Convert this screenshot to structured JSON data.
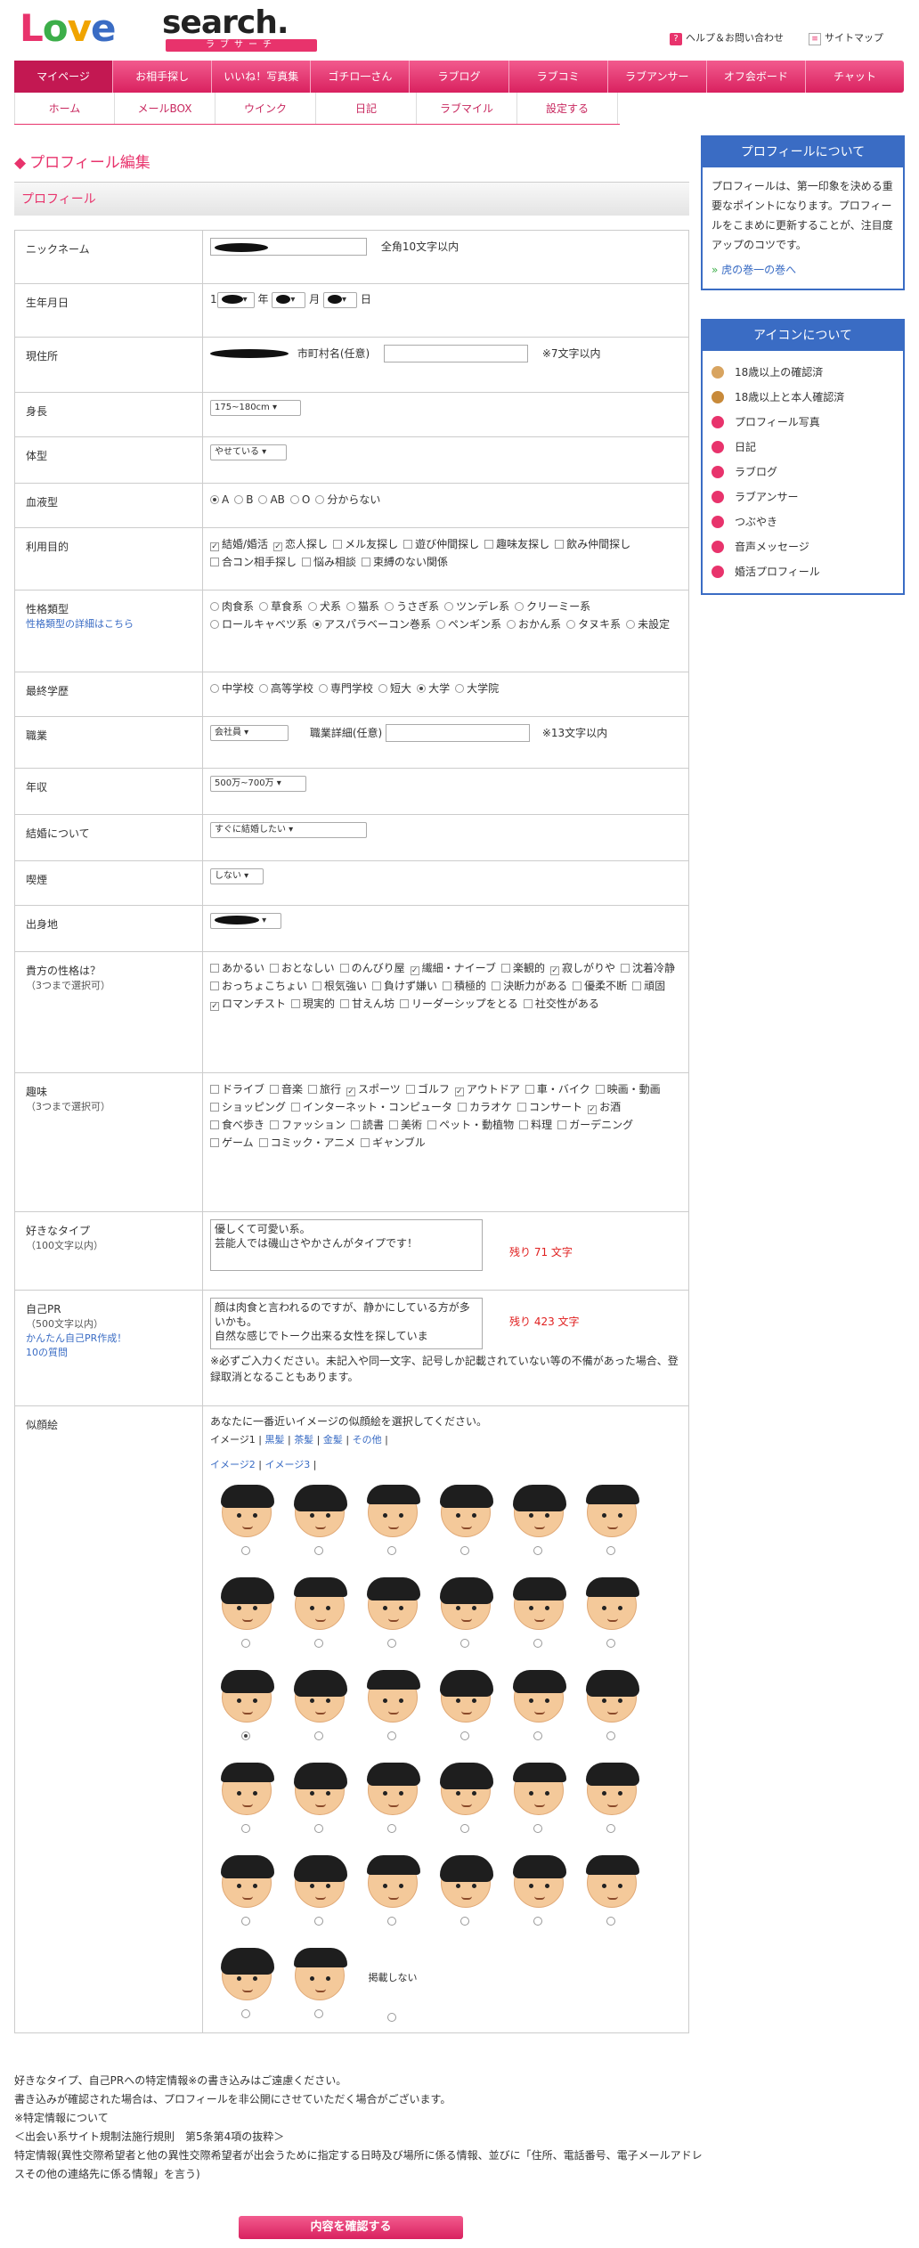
{
  "header": {
    "logo_love": [
      "L",
      "o",
      "v",
      "e"
    ],
    "logo_search": "search.",
    "logo_sub": "ラブサーチ",
    "help": "ヘルプ＆お問い合わせ",
    "sitemap": "サイトマップ"
  },
  "gnav": [
    "マイページ",
    "お相手探し",
    "いいね！写真集",
    "ゴチロ一さん",
    "ラブログ",
    "ラブコミ",
    "ラブアンサー",
    "オフ会ボード",
    "チャット"
  ],
  "snav": [
    "ホーム",
    "メールBOX",
    "ウインク",
    "日記",
    "ラブマイル",
    "設定する"
  ],
  "page_title": "プロフィール編集",
  "section_title": "プロフィール",
  "form": {
    "nickname": {
      "label": "ニックネーム",
      "hint": "全角10文字以内"
    },
    "birth": {
      "label": "生年月日",
      "year_prefix": "1",
      "year": "年",
      "month": "月",
      "day": "日"
    },
    "address": {
      "label": "現住所",
      "town": "市町村名(任意)",
      "hint": "※7文字以内"
    },
    "height": {
      "label": "身長",
      "value": "175~180cm"
    },
    "body": {
      "label": "体型",
      "value": "やせている"
    },
    "blood": {
      "label": "血液型",
      "options": [
        "A",
        "B",
        "AB",
        "O",
        "分からない"
      ],
      "selected": 0
    },
    "purpose": {
      "label": "利用目的",
      "options": [
        "結婚/婚活",
        "恋人探し",
        "メル友探し",
        "遊び仲間探し",
        "趣味友探し",
        "飲み仲間探し",
        "合コン相手探し",
        "悩み相談",
        "束縛のない関係"
      ],
      "checked": [
        0,
        1
      ]
    },
    "ptype": {
      "label": "性格類型",
      "link": "性格類型の詳細はこちら",
      "options": [
        "肉食系",
        "草食系",
        "犬系",
        "猫系",
        "うさぎ系",
        "ツンデレ系",
        "クリーミー系",
        "ロールキャベツ系",
        "アスパラベーコン巻系",
        "ペンギン系",
        "おかん系",
        "タヌキ系",
        "未設定"
      ],
      "selected": 8
    },
    "edu": {
      "label": "最終学歴",
      "options": [
        "中学校",
        "高等学校",
        "専門学校",
        "短大",
        "大学",
        "大学院"
      ],
      "selected": 4
    },
    "job": {
      "label": "職業",
      "value": "会社員",
      "detail": "職業詳細(任意)",
      "hint": "※13文字以内"
    },
    "income": {
      "label": "年収",
      "value": "500万~700万"
    },
    "marriage": {
      "label": "結婚について",
      "value": "すぐに結婚したい"
    },
    "smoke": {
      "label": "喫煙",
      "value": "しない"
    },
    "hometown": {
      "label": "出身地"
    },
    "personality": {
      "label": "貴方の性格は？",
      "sub": "（3つまで選択可）",
      "options": [
        "あかるい",
        "おとなしい",
        "のんびり屋",
        "繊細・ナイーブ",
        "楽観的",
        "寂しがりや",
        "沈着冷静",
        "おっちょこちょい",
        "根気強い",
        "負けず嫌い",
        "積極的",
        "決断力がある",
        "優柔不断",
        "頑固",
        "ロマンチスト",
        "現実的",
        "甘えん坊",
        "リーダーシップをとる",
        "社交性がある"
      ],
      "checked": [
        3,
        5,
        14
      ]
    },
    "hobby": {
      "label": "趣味",
      "sub": "（3つまで選択可）",
      "options": [
        "ドライブ",
        "音楽",
        "旅行",
        "スポーツ",
        "ゴルフ",
        "アウトドア",
        "車・バイク",
        "映画・動画",
        "ショッピング",
        "インターネット・コンピュータ",
        "カラオケ",
        "コンサート",
        "お酒",
        "食べ歩き",
        "ファッション",
        "読書",
        "美術",
        "ペット・動植物",
        "料理",
        "ガーデニング",
        "ゲーム",
        "コミック・アニメ",
        "ギャンブル"
      ],
      "checked": [
        3,
        5,
        12
      ]
    },
    "liketype": {
      "label": "好きなタイプ",
      "sub": "（100文字以内）",
      "text": "優しくて可愛い系。\n芸能人では磯山さやかさんがタイプです！",
      "remain": "残り 71 文字"
    },
    "pr": {
      "label": "自己PR",
      "sub": "（500文字以内）",
      "link1": "かんたん自己PR作成！",
      "link2": "10の質問",
      "text": "顔は肉食と言われるのですが、静かにしている方が多いかも。\n自然な感じでトーク出来る女性を探していま",
      "remain": "残り 423 文字",
      "note": "※必ずご入力ください。未記入や同一文字、記号しか記載されていない等の不備があった場合、登録取消となることもあります。"
    },
    "avatar": {
      "label": "似顔絵",
      "intro": "あなたに一番近いイメージの似顔絵を選択してください。",
      "tabs": [
        "イメージ1",
        "黒髪",
        "茶髪",
        "金髪",
        "その他",
        "イメージ2",
        "イメージ3"
      ],
      "none": "掲載しない",
      "selected": 12
    }
  },
  "sidebar": {
    "profile_title": "プロフィールについて",
    "profile_text": "プロフィールは、第一印象を決める重要なポイントになります。プロフィールをこまめに更新することが、注目度アップのコツです。",
    "profile_link": "虎の巻一の巻へ",
    "icons_title": "アイコンについて",
    "icons": [
      {
        "label": "18歳以上の確認済",
        "color": "#d8a460"
      },
      {
        "label": "18歳以上と本人確認済",
        "color": "#c88a3a"
      },
      {
        "label": "プロフィール写真",
        "color": "#e8336c"
      },
      {
        "label": "日記",
        "color": "#e8336c"
      },
      {
        "label": "ラブログ",
        "color": "#e8336c"
      },
      {
        "label": "ラブアンサー",
        "color": "#e8336c"
      },
      {
        "label": "つぶやき",
        "color": "#e8336c"
      },
      {
        "label": "音声メッセージ",
        "color": "#e8336c"
      },
      {
        "label": "婚活プロフィール",
        "color": "#e8336c"
      }
    ]
  },
  "notes": [
    "好きなタイプ、自己PRへの特定情報※の書き込みはご遠慮ください。",
    "書き込みが確認された場合は、プロフィールを非公開にさせていただく場合がございます。",
    "※特定情報について",
    "＜出会い系サイト規制法施行規則　第5条第4項の抜粋＞",
    "特定情報(異性交際希望者と他の異性交際希望者が出会うために指定する日時及び場所に係る情報、並びに「住所、電話番号、電子メールアドレスその他の連絡先に係る情報」を言う)"
  ],
  "submit": "内容を確認する"
}
